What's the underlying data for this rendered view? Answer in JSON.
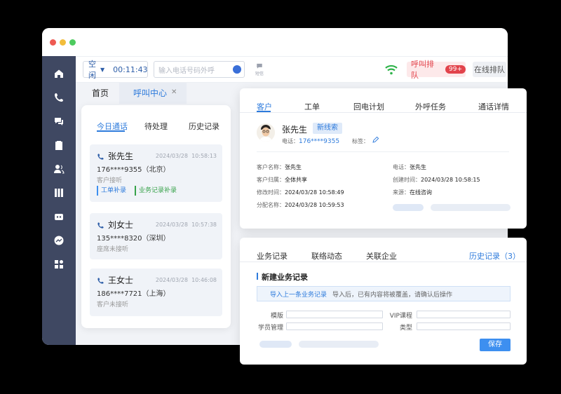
{
  "toolbar": {
    "status": "空闲",
    "timer": "00:11:43",
    "phone_placeholder": "输入电话号码外呼",
    "sms_label": "短信",
    "queue_label": "呼叫排队",
    "queue_badge": "99+",
    "online_queue_label": "在线排队"
  },
  "tabs": {
    "home": "首页",
    "call_center": "呼叫中心"
  },
  "calls": {
    "tabs": [
      "今日通话",
      "待处理",
      "历史记录"
    ],
    "items": [
      {
        "name": "张先生",
        "date": "2024/03/28",
        "time": "10:58:13",
        "phone": "176****9355（北京）",
        "note": "客户接听",
        "tags": [
          "工单补录",
          "业务记录补录"
        ]
      },
      {
        "name": "刘女士",
        "date": "2024/03/28",
        "time": "10:57:38",
        "phone": "135****8320（深圳）",
        "note": "座席未接听"
      },
      {
        "name": "王女士",
        "date": "2024/03/28",
        "time": "10:46:08",
        "phone": "186****7721（上海）",
        "note": "客户未接听"
      }
    ]
  },
  "customer": {
    "tabs": [
      "客户",
      "工单",
      "回电计划",
      "外呼任务",
      "通话详情"
    ],
    "name": "张先生",
    "lead_badge": "新线索",
    "phone_label": "电话：",
    "phone": "176****9355",
    "tag_label": "标签：",
    "fields": {
      "cname_label": "客户名称：",
      "cname": "张先生",
      "owner_label": "客户归属：",
      "owner": "全体共享",
      "modified_label": "修改时间：",
      "modified": "2024/03/28  10:58:49",
      "assigned_label": "分配名称：",
      "assigned": "2024/03/28  10:59:53",
      "tel_label": "电话：",
      "tel": "张先生",
      "created_label": "创建时间：",
      "created": "2024/03/28  10:58:15",
      "source_label": "来源：",
      "source": "在线咨询"
    }
  },
  "records": {
    "tabs": [
      "业务记录",
      "联络动态",
      "关联企业"
    ],
    "history": "历史记录（3）",
    "new_title": "新建业务记录",
    "import_link": "导入上一条业务记录",
    "import_tip": "导入后，已有内容将被覆盖，请确认后操作",
    "labels": {
      "template": "模版",
      "vip": "VIP课程",
      "student": "学员管理",
      "type": "类型"
    },
    "save": "保存"
  },
  "colors": {
    "accent": "#2e7bdc",
    "sidebar": "#3f4862",
    "danger": "#e2434b"
  }
}
